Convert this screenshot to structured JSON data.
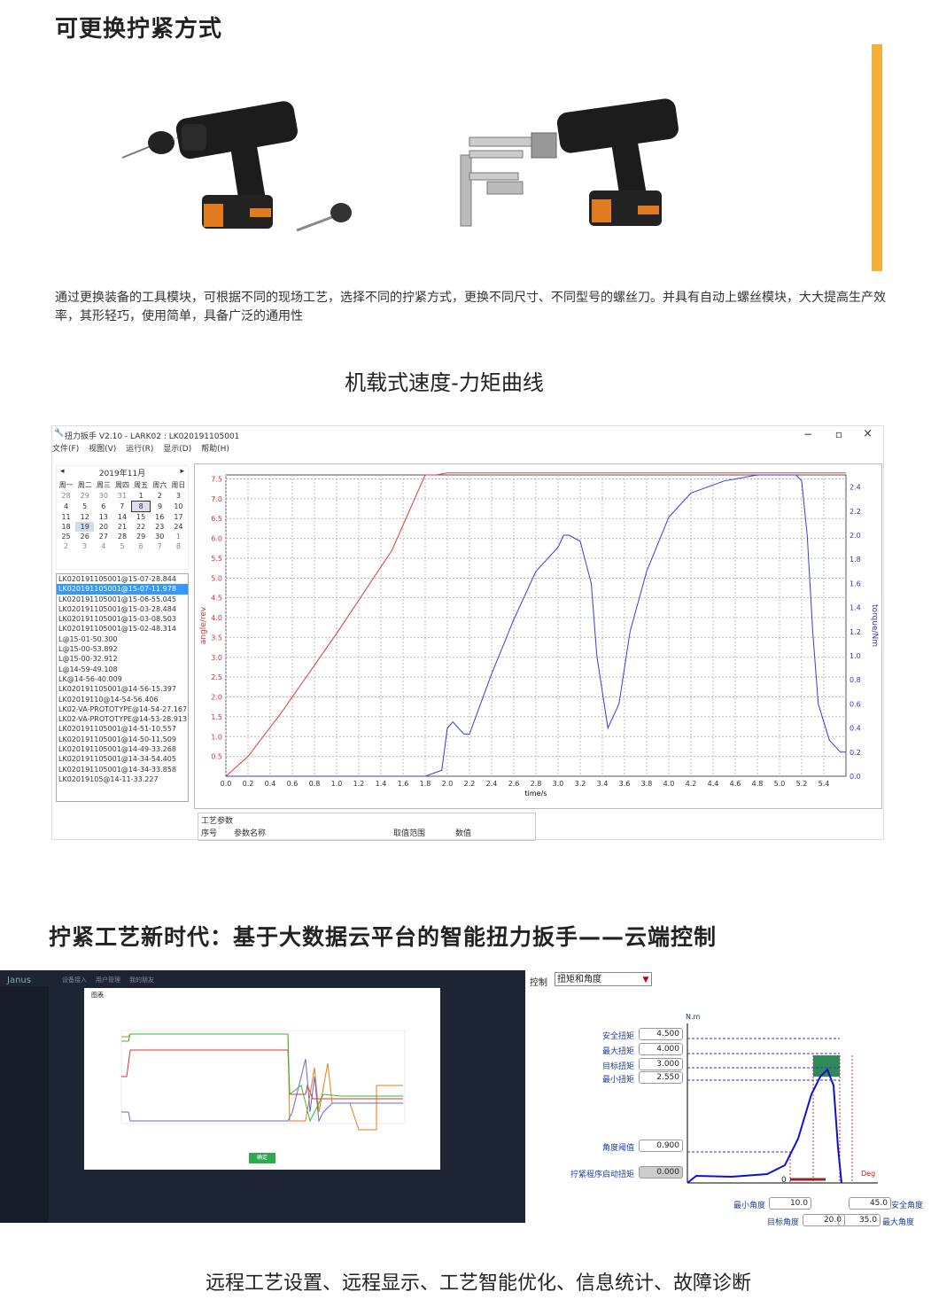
{
  "section1": {
    "title": "可更换拧紧方式",
    "description": "通过更换装备的工具模块，可根据不同的现场工艺，选择不同的拧紧方式，更换不同尺寸、不同型号的螺丝刀。并具有自动上螺丝模块，大大提高生产效率，其形轻巧，使用简单，具备广泛的通用性"
  },
  "section2": {
    "title": "机载式速度-力矩曲线",
    "window": {
      "title": "扭力扳手 V2.10 - LARK02 : LK020191105001",
      "controls": [
        "−",
        "▫",
        "×"
      ],
      "menu": [
        "文件(F)",
        "视图(V)",
        "运行(R)",
        "显示(D)",
        "帮助(H)"
      ],
      "calendar": {
        "month": "2019年11月",
        "weekdays": [
          "周一",
          "周二",
          "周三",
          "周四",
          "周五",
          "周六",
          "周日"
        ],
        "weeks": [
          [
            "28",
            "29",
            "30",
            "31",
            "1",
            "2",
            "3"
          ],
          [
            "4",
            "5",
            "6",
            "7",
            "8",
            "9",
            "10"
          ],
          [
            "11",
            "12",
            "13",
            "14",
            "15",
            "16",
            "17"
          ],
          [
            "18",
            "19",
            "20",
            "21",
            "22",
            "23",
            "24"
          ],
          [
            "25",
            "26",
            "27",
            "28",
            "29",
            "30",
            "1"
          ],
          [
            "2",
            "3",
            "4",
            "5",
            "6",
            "7",
            "8"
          ]
        ]
      },
      "log_items": [
        "LK020191105001@15-07-28.844",
        "LK020191105001@15-07-11.978",
        "LK020191105001@15-06-55.045",
        "LK020191105001@15-03-28.484",
        "LK020191105001@15-03-08.503",
        "LK020191105001@15-02-48.314",
        "L@15-01-50.300",
        "L@15-00-53.892",
        "L@15-00-32.912",
        "L@14-59-49.108",
        "LK@14-56-40.009",
        "LK020191105001@14-56-15.397",
        "LK02019110@14-54-56.406",
        "LK02-VA-PROTOTYPE@14-54-27.167",
        "LK02-VA-PROTOTYPE@14-53-28.913",
        "LK020191105001@14-51-10.557",
        "LK020191105001@14-50-11.509",
        "LK020191105001@14-49-33.268",
        "LK020191105001@14-34-54.405",
        "LK020191105001@14-34-33.858",
        "LK02019105@14-11-33.227"
      ],
      "params_title": "工艺参数",
      "params_columns": [
        "序号",
        "参数名称",
        "取值范围",
        "数值"
      ]
    }
  },
  "chart_data": {
    "type": "line",
    "xlabel": "time/s",
    "ylabel": "angle/rev",
    "y2label": "torque/Nm",
    "xlim": [
      0,
      5.6
    ],
    "ylim": [
      0,
      7.6
    ],
    "y2lim": [
      0,
      2.5
    ],
    "xticks": [
      "0.0",
      "0.2",
      "0.4",
      "0.6",
      "0.8",
      "1.0",
      "1.2",
      "1.4",
      "1.6",
      "1.8",
      "2.0",
      "2.2",
      "2.4",
      "2.6",
      "2.8",
      "3.0",
      "3.2",
      "3.4",
      "3.6",
      "3.8",
      "4.0",
      "4.2",
      "4.4",
      "4.6",
      "4.8",
      "5.0",
      "5.2",
      "5.4"
    ],
    "yticks": [
      "0.5",
      "1.0",
      "1.5",
      "2.0",
      "2.5",
      "3.0",
      "3.5",
      "4.0",
      "4.5",
      "5.0",
      "5.5",
      "6.0",
      "6.5",
      "7.0",
      "7.5"
    ],
    "y2ticks": [
      "0.0",
      "0.2",
      "0.4",
      "0.6",
      "0.8",
      "1.0",
      "1.2",
      "1.4",
      "1.6",
      "1.8",
      "2.0",
      "2.2",
      "2.4"
    ],
    "grid": true,
    "series": [
      {
        "axis": "left",
        "color": "#e23a3a",
        "x": [
          0,
          0.2,
          0.5,
          1.0,
          1.5,
          1.8,
          1.9,
          2.0,
          2.5,
          3.0,
          4.0,
          5.0,
          5.6
        ],
        "y": [
          0,
          0.5,
          1.6,
          3.6,
          5.7,
          7.6,
          7.6,
          7.65,
          7.65,
          7.65,
          7.65,
          7.65,
          7.65
        ]
      },
      {
        "axis": "right",
        "color": "#3a3ad8",
        "x": [
          0,
          1.8,
          1.95,
          2.0,
          2.05,
          2.1,
          2.15,
          2.2,
          2.4,
          2.6,
          2.8,
          3.0,
          3.05,
          3.1,
          3.2,
          3.3,
          3.35,
          3.45,
          3.55,
          3.65,
          3.8,
          4.0,
          4.2,
          4.5,
          4.8,
          5.0,
          5.15,
          5.2,
          5.25,
          5.3,
          5.35,
          5.45,
          5.55,
          5.6
        ],
        "y": [
          0,
          0,
          0.05,
          0.4,
          0.45,
          0.4,
          0.35,
          0.35,
          0.85,
          1.3,
          1.7,
          1.9,
          2.0,
          2.0,
          1.95,
          1.6,
          1.0,
          0.4,
          0.6,
          1.2,
          1.7,
          2.15,
          2.35,
          2.45,
          2.5,
          2.5,
          2.5,
          2.45,
          2.0,
          1.2,
          0.6,
          0.3,
          0.2,
          0.2
        ]
      }
    ]
  },
  "section3": {
    "title": "拧紧工艺新时代：基于大数据云平台的智能扭力扳手——云端控制",
    "cloud_app": {
      "logo": "Janus",
      "nav": [
        "设备接入",
        "用户管理",
        "我的朋友"
      ],
      "dialog_title": "图表",
      "ok_button": "确定"
    },
    "control_panel": {
      "label": "控制",
      "select_value": "扭矩和角度",
      "y_unit": "N.m",
      "x_unit": "Deg",
      "origin": "0",
      "fields": [
        {
          "label": "安全扭矩",
          "value": "4.500"
        },
        {
          "label": "最大扭矩",
          "value": "4.000"
        },
        {
          "label": "目标扭矩",
          "value": "3.000"
        },
        {
          "label": "最小扭矩",
          "value": "2.550"
        },
        {
          "label": "角度阈值",
          "value": "0.900"
        },
        {
          "label": "拧紧程序启动扭矩",
          "value": "0.000"
        }
      ],
      "angles": [
        {
          "label": "最小角度",
          "value": "10.0"
        },
        {
          "label": "目标角度",
          "value": "20.0"
        },
        {
          "label": "安全角度",
          "value": "45.0"
        },
        {
          "label": "最大角度",
          "value": "35.0"
        }
      ]
    },
    "footer": "远程工艺设置、远程显示、工艺智能优化、信息统计、故障诊断"
  }
}
